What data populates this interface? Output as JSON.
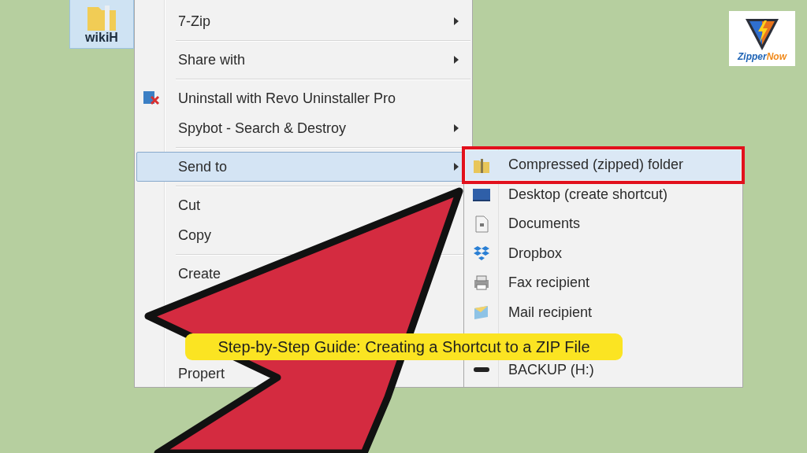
{
  "desktop_icon": {
    "label": "wikiH",
    "selected": true
  },
  "context_menu": {
    "items": [
      {
        "kind": "item",
        "label": "7-Zip",
        "submenu": true,
        "selected": false
      },
      {
        "kind": "separator"
      },
      {
        "kind": "item",
        "label": "Share with",
        "submenu": true,
        "selected": false
      },
      {
        "kind": "separator"
      },
      {
        "kind": "item",
        "label": "Uninstall with Revo Uninstaller Pro",
        "submenu": false,
        "selected": false,
        "has_icon": true
      },
      {
        "kind": "item",
        "label": "Spybot - Search & Destroy",
        "submenu": true,
        "selected": false
      },
      {
        "kind": "separator"
      },
      {
        "kind": "item",
        "label": "Send to",
        "submenu": true,
        "selected": true
      },
      {
        "kind": "separator"
      },
      {
        "kind": "item",
        "label": "Cut",
        "submenu": false,
        "selected": false
      },
      {
        "kind": "item",
        "label": "Copy",
        "submenu": false,
        "selected": false
      },
      {
        "kind": "separator"
      },
      {
        "kind": "item",
        "label": "Create",
        "submenu": false,
        "selected": false
      },
      {
        "kind": "item",
        "label": "Propert",
        "submenu": false,
        "selected": false
      }
    ]
  },
  "send_to_menu": {
    "items": [
      {
        "label": "Compressed (zipped) folder",
        "selected": true
      },
      {
        "label": "Desktop (create shortcut)",
        "selected": false
      },
      {
        "label": "Documents",
        "selected": false
      },
      {
        "label": "Dropbox",
        "selected": false
      },
      {
        "label": "Fax recipient",
        "selected": false
      },
      {
        "label": "Mail recipient",
        "selected": false
      },
      {
        "label": "BACKUP (H:)",
        "selected": false
      }
    ]
  },
  "caption": "Step-by-Step Guide: Creating a Shortcut to a ZIP File",
  "logo": {
    "parts": [
      "Zipper",
      "Now"
    ]
  }
}
